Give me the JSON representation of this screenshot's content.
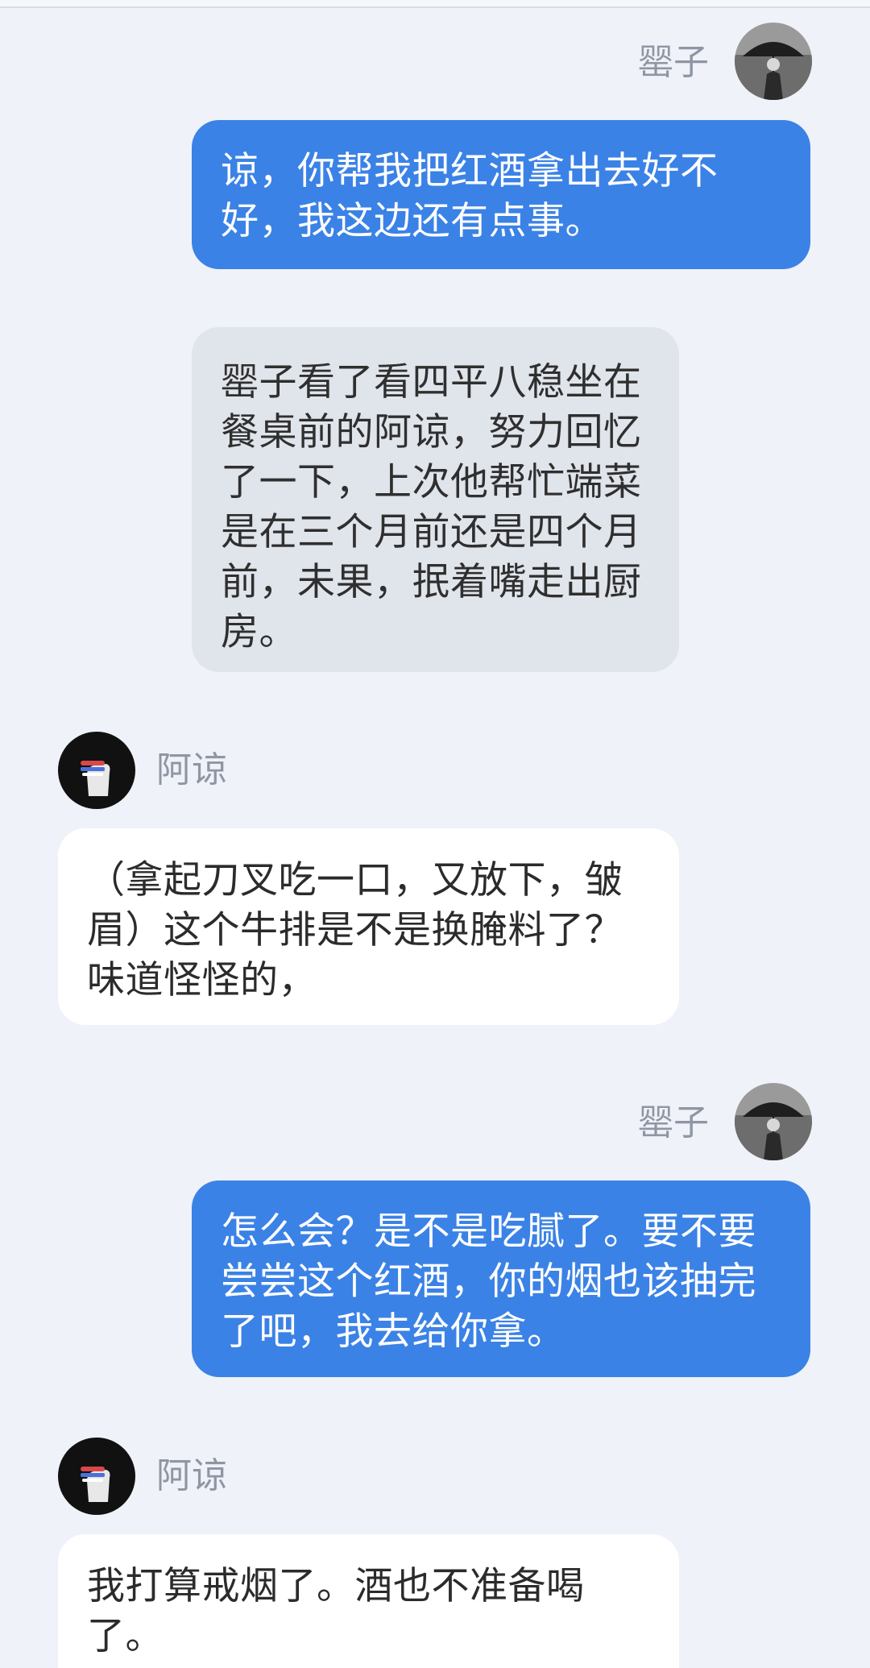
{
  "characters": {
    "self": {
      "name": "罂子",
      "avatar_icon": "woman-with-umbrella-avatar-icon"
    },
    "other": {
      "name": "阿谅",
      "avatar_icon": "hand-holding-cigarette-avatar-icon"
    }
  },
  "messages": [
    {
      "speaker": "self",
      "name": "罂子",
      "text": "谅，你帮我把红酒拿出去好不好，我这边还有点事。"
    },
    {
      "speaker": "narration",
      "text": "罂子看了看四平八稳坐在餐桌前的阿谅，努力回忆了一下，上次他帮忙端菜是在三个月前还是四个月前，未果，抿着嘴走出厨房。"
    },
    {
      "speaker": "other",
      "name": "阿谅",
      "text": "（拿起刀叉吃一口，又放下，皱眉）这个牛排是不是换腌料了？味道怪怪的，"
    },
    {
      "speaker": "self",
      "name": "罂子",
      "text": "怎么会？是不是吃腻了。要不要尝尝这个红酒，你的烟也该抽完了吧，我去给你拿。"
    },
    {
      "speaker": "other",
      "name": "阿谅",
      "text": "我打算戒烟了。酒也不准备喝了。"
    }
  ],
  "colors": {
    "background": "#eff2f8",
    "self_bubble": "#3b82e6",
    "other_bubble": "#ffffff",
    "narration_bubble": "#e0e4eb",
    "name_text": "#8f96a3"
  }
}
